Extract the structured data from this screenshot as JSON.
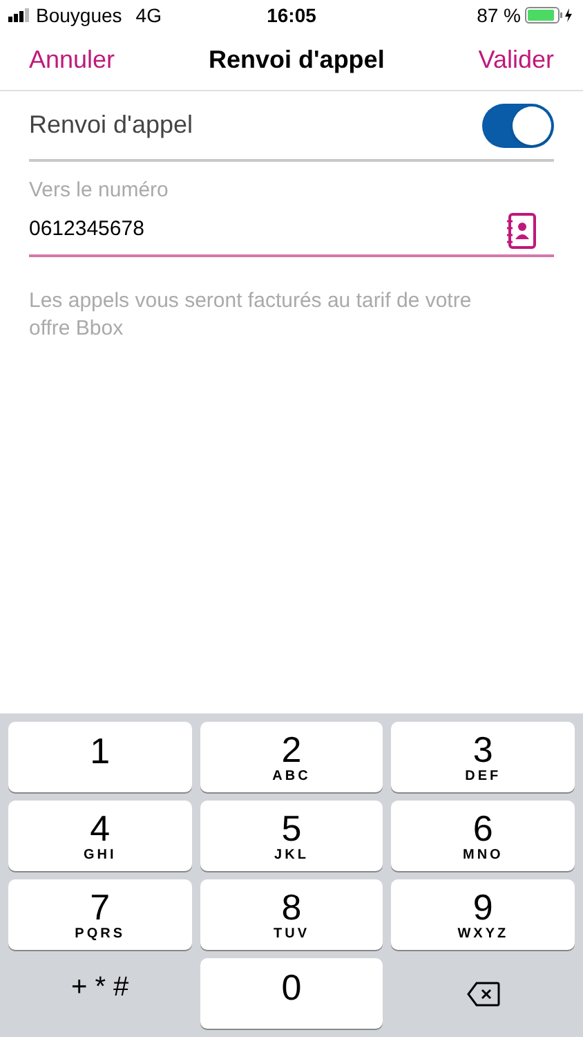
{
  "status_bar": {
    "carrier": "Bouygues",
    "network": "4G",
    "time": "16:05",
    "battery": "87 %"
  },
  "nav": {
    "cancel": "Annuler",
    "title": "Renvoi d'appel",
    "confirm": "Valider"
  },
  "forward_toggle": {
    "label": "Renvoi d'appel",
    "on": true
  },
  "number_field": {
    "label": "Vers le numéro",
    "value": "0612345678"
  },
  "note": "Les appels vous seront facturés au tarif de votre offre Bbox",
  "keypad": [
    {
      "kind": "digit",
      "digit": "1"
    },
    {
      "kind": "digit",
      "digit": "2",
      "letters": "ABC"
    },
    {
      "kind": "digit",
      "digit": "3",
      "letters": "DEF"
    },
    {
      "kind": "digit",
      "digit": "4",
      "letters": "GHI"
    },
    {
      "kind": "digit",
      "digit": "5",
      "letters": "JKL"
    },
    {
      "kind": "digit",
      "digit": "6",
      "letters": "MNO"
    },
    {
      "kind": "digit",
      "digit": "7",
      "letters": "PQRS"
    },
    {
      "kind": "digit",
      "digit": "8",
      "letters": "TUV"
    },
    {
      "kind": "digit",
      "digit": "9",
      "letters": "WXYZ"
    },
    {
      "kind": "symbols",
      "label": "+ * #"
    },
    {
      "kind": "digit",
      "digit": "0"
    },
    {
      "kind": "delete"
    }
  ]
}
